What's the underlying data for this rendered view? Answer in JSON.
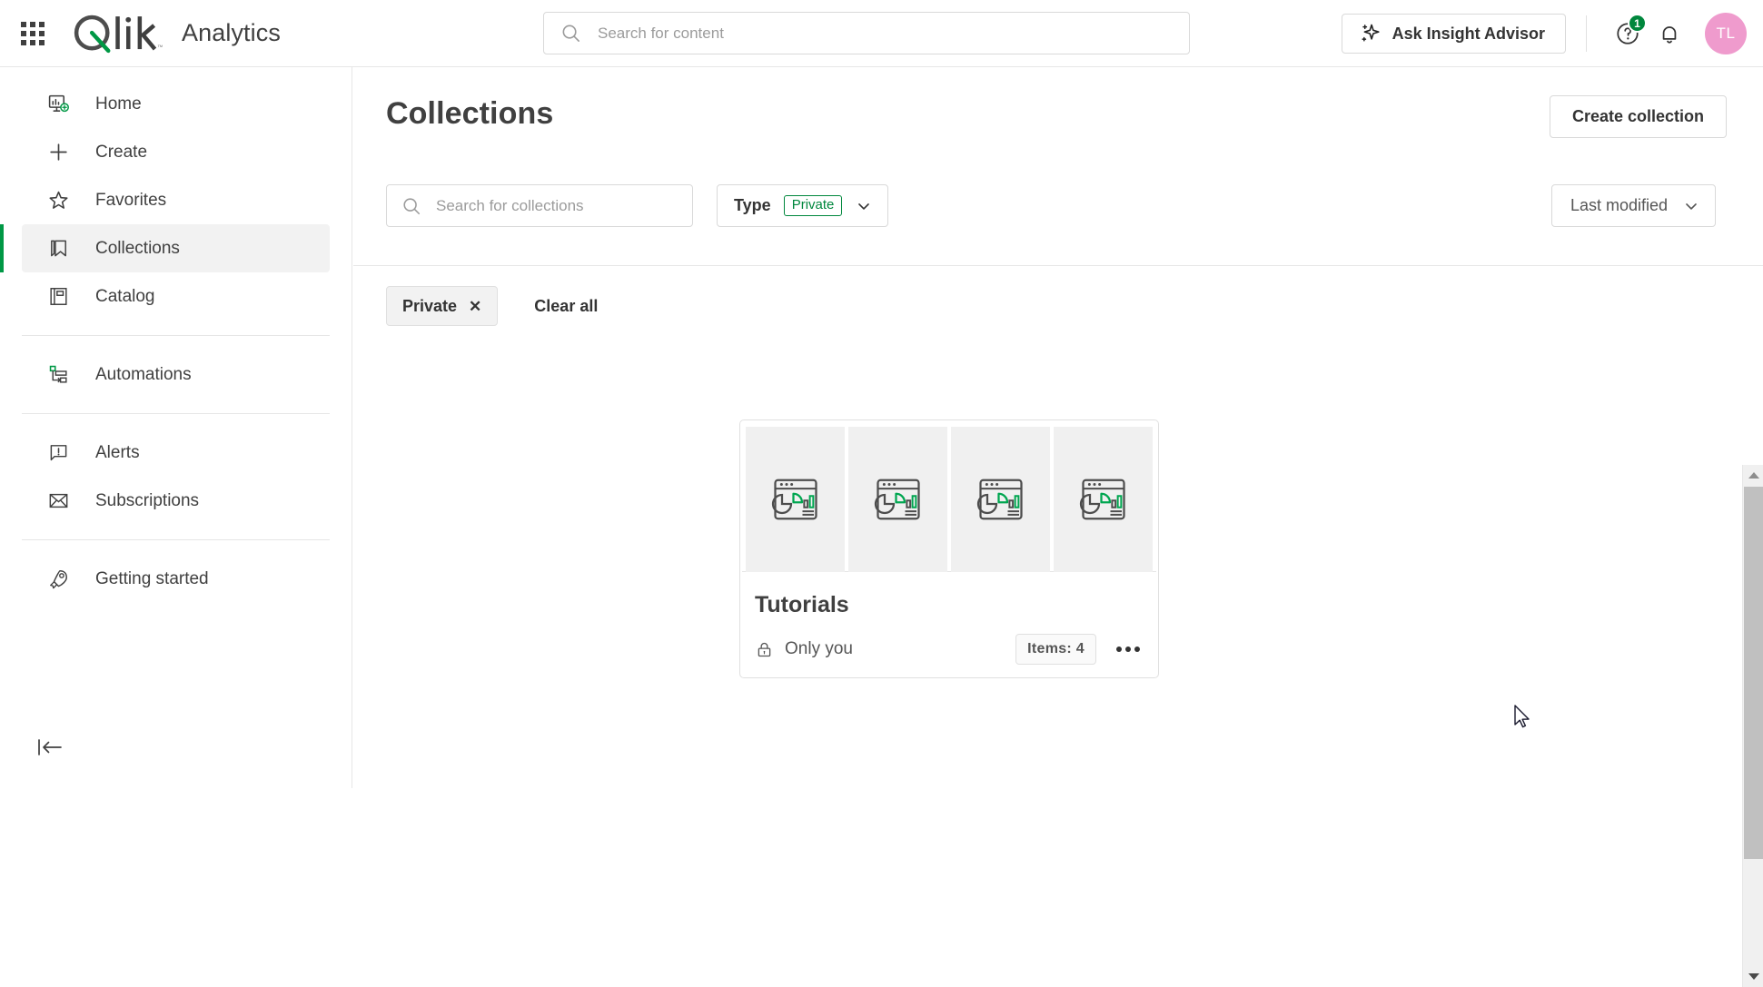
{
  "app": {
    "brand_name": "Qlik",
    "title": "Analytics",
    "launcher_icon": "app-grid-icon"
  },
  "header": {
    "search": {
      "placeholder": "Search for content",
      "value": "",
      "icon": "search-icon"
    },
    "insight_advisor": {
      "label": "Ask Insight Advisor",
      "icon": "sparkle-icon"
    },
    "help": {
      "icon": "help-circle-icon",
      "badge": "1",
      "badge_color": "#00873d"
    },
    "notifications": {
      "icon": "bell-icon"
    },
    "avatar": {
      "initials": "TL",
      "color": "#ef9bcd"
    }
  },
  "sidebar": {
    "items": [
      {
        "label": "Home",
        "icon": "home-dashboard-icon",
        "active": false
      },
      {
        "label": "Create",
        "icon": "plus-icon",
        "active": false
      },
      {
        "label": "Favorites",
        "icon": "star-icon",
        "active": false
      },
      {
        "label": "Collections",
        "icon": "bookmark-icon",
        "active": true
      },
      {
        "label": "Catalog",
        "icon": "book-icon",
        "active": false
      },
      {
        "label": "Automations",
        "icon": "automation-flow-icon",
        "active": false
      },
      {
        "label": "Alerts",
        "icon": "alert-bubble-icon",
        "active": false
      },
      {
        "label": "Subscriptions",
        "icon": "envelope-icon",
        "active": false
      },
      {
        "label": "Getting started",
        "icon": "rocket-icon",
        "active": false
      }
    ],
    "collapse": {
      "icon": "collapse-left-icon"
    },
    "active_color": "#009845"
  },
  "main": {
    "page_title": "Collections",
    "create_collection_label": "Create collection",
    "search": {
      "placeholder": "Search for collections",
      "value": "",
      "icon": "search-icon"
    },
    "type_filter": {
      "label": "Type",
      "selected": "Private",
      "chevron": "chevron-down-icon",
      "accent": "#00873d"
    },
    "sort": {
      "label": "Last modified",
      "chevron": "chevron-down-icon"
    },
    "active_filters": [
      {
        "label": "Private",
        "remove_icon": "close-icon"
      }
    ],
    "clear_all_label": "Clear all",
    "collections": [
      {
        "name": "Tutorials",
        "owner": "Only you",
        "owner_icon": "lock-icon",
        "items_label": "Items: 4",
        "item_count": 4,
        "thumbnail_count": 4,
        "thumbnail_icon": "app-chart-icon",
        "more_icon": "more-horizontal-icon"
      }
    ]
  },
  "scrollbar": {
    "up_icon": "triangle-up-icon",
    "down_icon": "triangle-down-icon",
    "position": "top"
  }
}
